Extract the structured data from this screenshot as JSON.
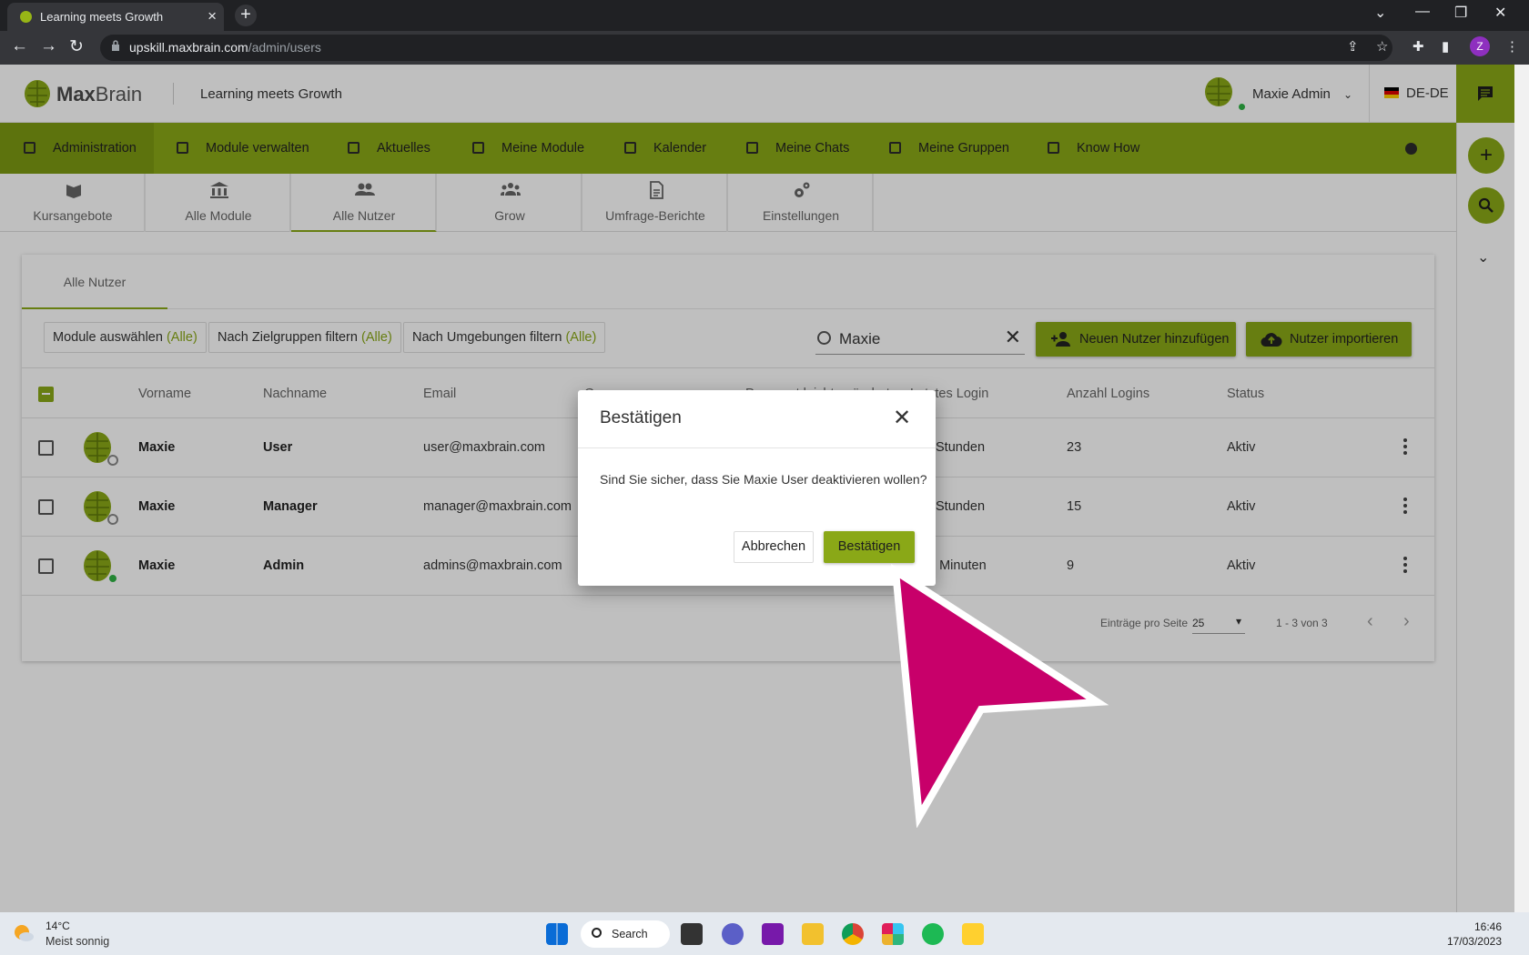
{
  "browser": {
    "tab_title": "Learning meets Growth",
    "url_host": "upskill.maxbrain.com",
    "url_path": "/admin/users",
    "profile_initial": "Z"
  },
  "header": {
    "brand_bold": "Max",
    "brand_light": "Brain",
    "tagline": "Learning meets Growth",
    "user_name": "Maxie Admin",
    "language": "DE-DE"
  },
  "main_nav": [
    {
      "label": "Administration",
      "icon": "admin-icon"
    },
    {
      "label": "Module verwalten",
      "icon": "folder-icon"
    },
    {
      "label": "Aktuelles",
      "icon": "news-icon"
    },
    {
      "label": "Meine Module",
      "icon": "graduation-cap-icon"
    },
    {
      "label": "Kalender",
      "icon": "calendar-icon"
    },
    {
      "label": "Meine Chats",
      "icon": "chat-icon"
    },
    {
      "label": "Meine Gruppen",
      "icon": "groups-icon"
    },
    {
      "label": "Know How",
      "icon": "book-icon"
    }
  ],
  "sub_nav": [
    {
      "label": "Kursangebote",
      "icon": "course-offer-icon"
    },
    {
      "label": "Alle Module",
      "icon": "institution-icon"
    },
    {
      "label": "Alle Nutzer",
      "icon": "users-icon"
    },
    {
      "label": "Grow",
      "icon": "grow-icon"
    },
    {
      "label": "Umfrage-Berichte",
      "icon": "report-icon"
    },
    {
      "label": "Einstellungen",
      "icon": "settings-icon"
    }
  ],
  "card": {
    "tab": "Alle Nutzer",
    "filters": [
      {
        "label": "Module auswählen",
        "value": "(Alle)"
      },
      {
        "label": "Nach Zielgruppen filtern",
        "value": "(Alle)"
      },
      {
        "label": "Nach Umgebungen filtern",
        "value": "(Alle)"
      }
    ],
    "search_value": "Maxie",
    "add_user_label": "Neuen Nutzer hinzufügen",
    "import_label": "Nutzer importieren",
    "columns": [
      "Vorname",
      "Nachname",
      "Email",
      "Gruppe",
      "Passwort leicht geändert",
      "Letztes Login",
      "Anzahl Logins",
      "Status"
    ],
    "rows": [
      {
        "first": "Maxie",
        "last": "User",
        "email": "user@maxbrain.com",
        "last_login": "Stunden",
        "logins": "23",
        "status": "Aktiv",
        "online": false
      },
      {
        "first": "Maxie",
        "last": "Manager",
        "email": "manager@maxbrain.com",
        "last_login": "Stunden",
        "logins": "15",
        "status": "Aktiv",
        "online": false
      },
      {
        "first": "Maxie",
        "last": "Admin",
        "email": "admins@maxbrain.com",
        "last_login": "2 Minuten",
        "logins": "9",
        "status": "Aktiv",
        "online": true
      }
    ],
    "pager": {
      "per_page_label": "Einträge pro Seite",
      "per_page": "25",
      "range": "1 - 3 von 3"
    }
  },
  "dialog": {
    "title": "Bestätigen",
    "message": "Sind Sie sicher, dass Sie Maxie User deaktivieren wollen?",
    "cancel": "Abbrechen",
    "confirm": "Bestätigen"
  },
  "taskbar": {
    "temp": "14°C",
    "weather": "Meist sonnig",
    "search": "Search",
    "time": "16:46",
    "date": "17/03/2023"
  },
  "colors": {
    "brand": "#8aa817",
    "arrow": "#c8006a"
  }
}
